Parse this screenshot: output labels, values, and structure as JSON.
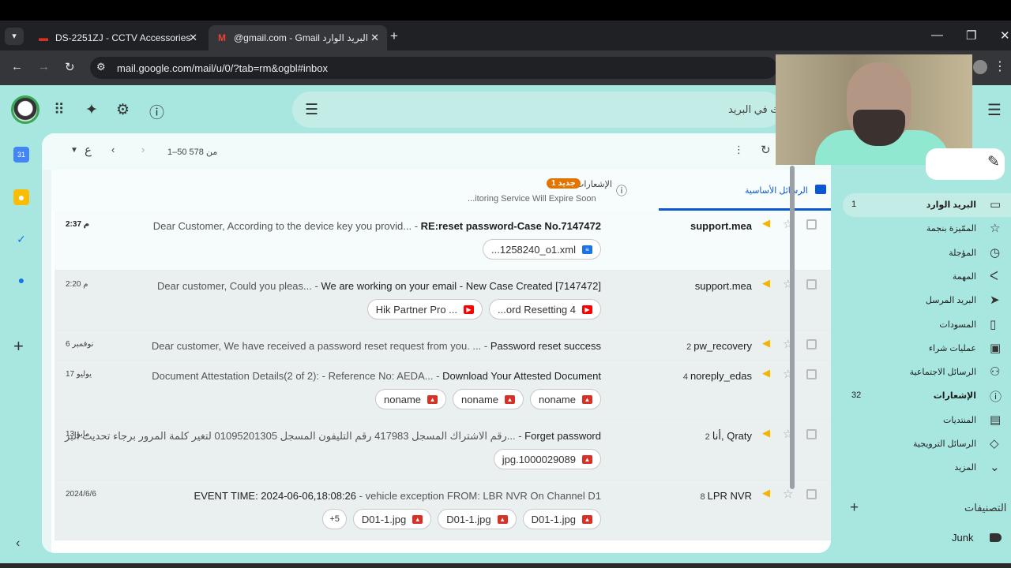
{
  "browser": {
    "tab_list_icon": "chevron-down-icon",
    "tabs": [
      {
        "title": "DS-2251ZJ - CCTV Accessories",
        "favicon": "hikvision-icon"
      },
      {
        "title": "@gmail.com - Gmail البريد الوارد",
        "favicon": "gmail-icon"
      }
    ],
    "new_tab": "+",
    "url": "mail.google.com/mail/u/0/?tab=rm&ogbl#inbox"
  },
  "header": {
    "search_placeholder": "البحث في البريد"
  },
  "toolbar": {
    "page_count": "1–50 من 578",
    "lang_key": "ع"
  },
  "tabs": {
    "primary": "الرسائل الأساسية",
    "notifications": "الإشعارات",
    "notifications_badge": "1 جديد",
    "notifications_snippet": "...itoring Service Will Expire Soon"
  },
  "emails": [
    {
      "sender": "support.mea",
      "count": "",
      "subject": "RE:reset password-Case No.7147472",
      "snippet": "Dear Customer, According to the device key you provid...",
      "date": "2:37 م",
      "unread": true,
      "attachments": [
        {
          "name": "...1258240_o1.xml",
          "type": "doc"
        }
      ]
    },
    {
      "sender": "support.mea",
      "count": "",
      "subject": "We are working on your email - New Case Created [7147472]",
      "snippet": "Dear customer,   Could you pleas...",
      "date": "2:20 م",
      "unread": false,
      "attachments": [
        {
          "name": "...ord Resetting 4",
          "type": "yt"
        },
        {
          "name": "Hik Partner Pro ...",
          "type": "yt"
        }
      ]
    },
    {
      "sender": "pw_recovery",
      "count": "2",
      "subject": "Password reset success",
      "snippet": "Dear customer, We have received a password reset request from you. ...",
      "date": "6 نوفمبر",
      "unread": false,
      "attachments": []
    },
    {
      "sender": "noreply_edas",
      "count": "4",
      "subject": "Download Your Attested Document",
      "snippet": "Document Attestation Details(2 of 2): - Reference No: AEDA...",
      "date": "17 يوليو",
      "unread": false,
      "attachments": [
        {
          "name": "noname",
          "type": "img"
        },
        {
          "name": "noname",
          "type": "img"
        },
        {
          "name": "noname",
          "type": "img"
        }
      ]
    },
    {
      "sender": "أنا, Qraty",
      "count": "2",
      "subject": "Forget password",
      "snippet": "رقم الاشتراك المسجل 417983 رقم التليفون المسجل 01095201305 لتغير كلمة المرور برجاء تحديث البر...",
      "date": "13 مايو",
      "unread": false,
      "attachments": [
        {
          "name": "jpg.1000029089",
          "type": "img"
        }
      ]
    },
    {
      "sender": "LPR NVR",
      "count": "8",
      "subject": "EVENT TIME: 2024-06-06,18:08:26",
      "snippet": "vehicle exception FROM: LBR NVR On Channel D1",
      "date": "2024/6/6",
      "unread": false,
      "subject_first": true,
      "attachments": [
        {
          "name": "D01-1.jpg",
          "type": "img"
        },
        {
          "name": "D01-1.jpg",
          "type": "img"
        },
        {
          "name": "D01-1.jpg",
          "type": "img"
        }
      ],
      "more": "+5"
    }
  ],
  "nav": [
    {
      "label": "البريد الوارد",
      "icon": "inbox-icon",
      "count": "1",
      "active": true
    },
    {
      "label": "الممّيزة بنجمة",
      "icon": "star-icon",
      "count": ""
    },
    {
      "label": "المؤجلة",
      "icon": "clock-icon",
      "count": ""
    },
    {
      "label": "المهمة",
      "icon": "important-icon",
      "count": ""
    },
    {
      "label": "البريد المرسل",
      "icon": "send-icon",
      "count": ""
    },
    {
      "label": "المسودات",
      "icon": "draft-icon",
      "count": ""
    },
    {
      "label": "عمليات شراء",
      "icon": "bag-icon",
      "count": ""
    },
    {
      "label": "الرسائل الاجتماعية",
      "icon": "social-icon",
      "count": ""
    },
    {
      "label": "الإشعارات",
      "icon": "info-icon",
      "count": "32",
      "bold": true
    },
    {
      "label": "المنتديات",
      "icon": "forum-icon",
      "count": ""
    },
    {
      "label": "الرسائل الترويجية",
      "icon": "tag-icon",
      "count": ""
    },
    {
      "label": "المزيد",
      "icon": "chevron-down-icon",
      "count": ""
    }
  ],
  "labels": {
    "header": "التصنيفات",
    "items": [
      {
        "label": "Junk",
        "icon": "label-icon"
      }
    ]
  }
}
